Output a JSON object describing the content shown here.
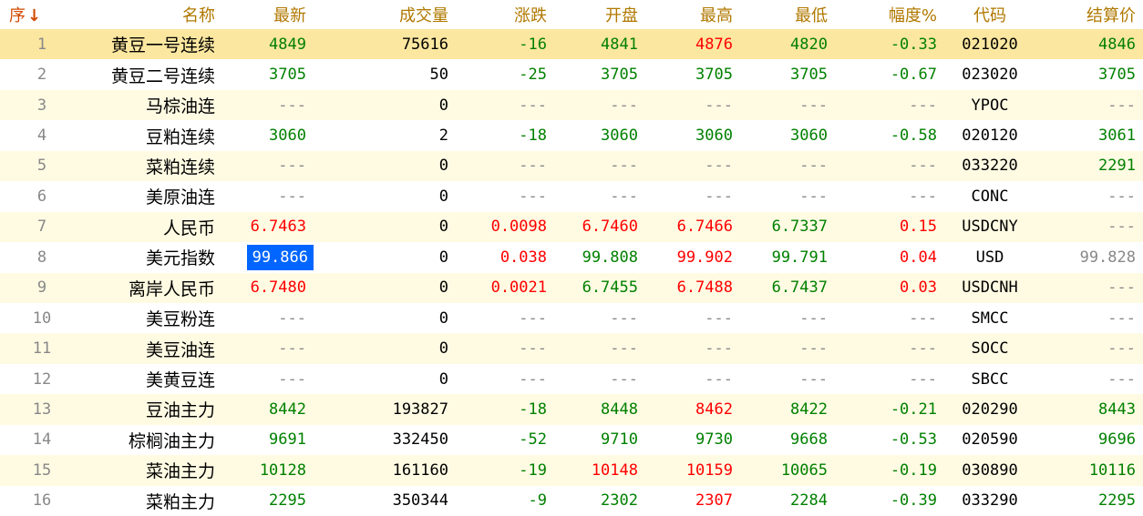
{
  "headers": {
    "seq": "序",
    "name": "名称",
    "last": "最新",
    "volume": "成交量",
    "change": "涨跌",
    "open": "开盘",
    "high": "最高",
    "low": "最低",
    "pct": "幅度%",
    "code": "代码",
    "settle": "结算价"
  },
  "sort_icon": "↓",
  "colors": {
    "up": "#ff0000",
    "down": "#008000",
    "flat": "#888888",
    "header": "#b07800",
    "highlight": "#0066ff"
  },
  "rows": [
    {
      "seq": "1",
      "name": "黄豆一号连续",
      "last": "4849",
      "last_c": "down",
      "volume": "75616",
      "change": "-16",
      "change_c": "down",
      "open": "4841",
      "open_c": "down",
      "high": "4876",
      "high_c": "up",
      "low": "4820",
      "low_c": "down",
      "pct": "-0.33",
      "pct_c": "down",
      "code": "021020",
      "settle": "4846",
      "settle_c": "down"
    },
    {
      "seq": "2",
      "name": "黄豆二号连续",
      "last": "3705",
      "last_c": "down",
      "volume": "50",
      "change": "-25",
      "change_c": "down",
      "open": "3705",
      "open_c": "down",
      "high": "3705",
      "high_c": "down",
      "low": "3705",
      "low_c": "down",
      "pct": "-0.67",
      "pct_c": "down",
      "code": "023020",
      "settle": "3705",
      "settle_c": "down"
    },
    {
      "seq": "3",
      "name": "马棕油连",
      "last": "---",
      "last_c": "flat",
      "volume": "0",
      "change": "---",
      "change_c": "flat",
      "open": "---",
      "open_c": "flat",
      "high": "---",
      "high_c": "flat",
      "low": "---",
      "low_c": "flat",
      "pct": "---",
      "pct_c": "flat",
      "code": "YPOC",
      "settle": "---",
      "settle_c": "flat"
    },
    {
      "seq": "4",
      "name": "豆粕连续",
      "last": "3060",
      "last_c": "down",
      "volume": "2",
      "change": "-18",
      "change_c": "down",
      "open": "3060",
      "open_c": "down",
      "high": "3060",
      "high_c": "down",
      "low": "3060",
      "low_c": "down",
      "pct": "-0.58",
      "pct_c": "down",
      "code": "020120",
      "settle": "3061",
      "settle_c": "down"
    },
    {
      "seq": "5",
      "name": "菜粕连续",
      "last": "---",
      "last_c": "flat",
      "volume": "0",
      "change": "---",
      "change_c": "flat",
      "open": "---",
      "open_c": "flat",
      "high": "---",
      "high_c": "flat",
      "low": "---",
      "low_c": "flat",
      "pct": "---",
      "pct_c": "flat",
      "code": "033220",
      "settle": "2291",
      "settle_c": "down"
    },
    {
      "seq": "6",
      "name": "美原油连",
      "last": "---",
      "last_c": "flat",
      "volume": "0",
      "change": "---",
      "change_c": "flat",
      "open": "---",
      "open_c": "flat",
      "high": "---",
      "high_c": "flat",
      "low": "---",
      "low_c": "flat",
      "pct": "---",
      "pct_c": "flat",
      "code": "CONC",
      "settle": "---",
      "settle_c": "flat"
    },
    {
      "seq": "7",
      "name": "人民币",
      "last": "6.7463",
      "last_c": "up",
      "volume": "0",
      "change": "0.0098",
      "change_c": "up",
      "open": "6.7460",
      "open_c": "up",
      "high": "6.7466",
      "high_c": "up",
      "low": "6.7337",
      "low_c": "down",
      "pct": "0.15",
      "pct_c": "up",
      "code": "USDCNY",
      "settle": "---",
      "settle_c": "flat"
    },
    {
      "seq": "8",
      "name": "美元指数",
      "last": "99.866",
      "last_c": "hl",
      "volume": "0",
      "change": "0.038",
      "change_c": "up",
      "open": "99.808",
      "open_c": "down",
      "high": "99.902",
      "high_c": "up",
      "low": "99.791",
      "low_c": "down",
      "pct": "0.04",
      "pct_c": "up",
      "code": "USD",
      "settle": "99.828",
      "settle_c": "flat"
    },
    {
      "seq": "9",
      "name": "离岸人民币",
      "last": "6.7480",
      "last_c": "up",
      "volume": "0",
      "change": "0.0021",
      "change_c": "up",
      "open": "6.7455",
      "open_c": "down",
      "high": "6.7488",
      "high_c": "up",
      "low": "6.7437",
      "low_c": "down",
      "pct": "0.03",
      "pct_c": "up",
      "code": "USDCNH",
      "settle": "---",
      "settle_c": "flat"
    },
    {
      "seq": "10",
      "name": "美豆粉连",
      "last": "---",
      "last_c": "flat",
      "volume": "0",
      "change": "---",
      "change_c": "flat",
      "open": "---",
      "open_c": "flat",
      "high": "---",
      "high_c": "flat",
      "low": "---",
      "low_c": "flat",
      "pct": "---",
      "pct_c": "flat",
      "code": "SMCC",
      "settle": "---",
      "settle_c": "flat"
    },
    {
      "seq": "11",
      "name": "美豆油连",
      "last": "---",
      "last_c": "flat",
      "volume": "0",
      "change": "---",
      "change_c": "flat",
      "open": "---",
      "open_c": "flat",
      "high": "---",
      "high_c": "flat",
      "low": "---",
      "low_c": "flat",
      "pct": "---",
      "pct_c": "flat",
      "code": "SOCC",
      "settle": "---",
      "settle_c": "flat"
    },
    {
      "seq": "12",
      "name": "美黄豆连",
      "last": "---",
      "last_c": "flat",
      "volume": "0",
      "change": "---",
      "change_c": "flat",
      "open": "---",
      "open_c": "flat",
      "high": "---",
      "high_c": "flat",
      "low": "---",
      "low_c": "flat",
      "pct": "---",
      "pct_c": "flat",
      "code": "SBCC",
      "settle": "---",
      "settle_c": "flat"
    },
    {
      "seq": "13",
      "name": "豆油主力",
      "last": "8442",
      "last_c": "down",
      "volume": "193827",
      "change": "-18",
      "change_c": "down",
      "open": "8448",
      "open_c": "down",
      "high": "8462",
      "high_c": "up",
      "low": "8422",
      "low_c": "down",
      "pct": "-0.21",
      "pct_c": "down",
      "code": "020290",
      "settle": "8443",
      "settle_c": "down"
    },
    {
      "seq": "14",
      "name": "棕榈油主力",
      "last": "9691",
      "last_c": "down",
      "volume": "332450",
      "change": "-52",
      "change_c": "down",
      "open": "9710",
      "open_c": "down",
      "high": "9730",
      "high_c": "down",
      "low": "9668",
      "low_c": "down",
      "pct": "-0.53",
      "pct_c": "down",
      "code": "020590",
      "settle": "9696",
      "settle_c": "down"
    },
    {
      "seq": "15",
      "name": "菜油主力",
      "last": "10128",
      "last_c": "down",
      "volume": "161160",
      "change": "-19",
      "change_c": "down",
      "open": "10148",
      "open_c": "up",
      "high": "10159",
      "high_c": "up",
      "low": "10065",
      "low_c": "down",
      "pct": "-0.19",
      "pct_c": "down",
      "code": "030890",
      "settle": "10116",
      "settle_c": "down"
    },
    {
      "seq": "16",
      "name": "菜粕主力",
      "last": "2295",
      "last_c": "down",
      "volume": "350344",
      "change": "-9",
      "change_c": "down",
      "open": "2302",
      "open_c": "down",
      "high": "2307",
      "high_c": "up",
      "low": "2284",
      "low_c": "down",
      "pct": "-0.39",
      "pct_c": "down",
      "code": "033290",
      "settle": "2295",
      "settle_c": "down"
    }
  ]
}
